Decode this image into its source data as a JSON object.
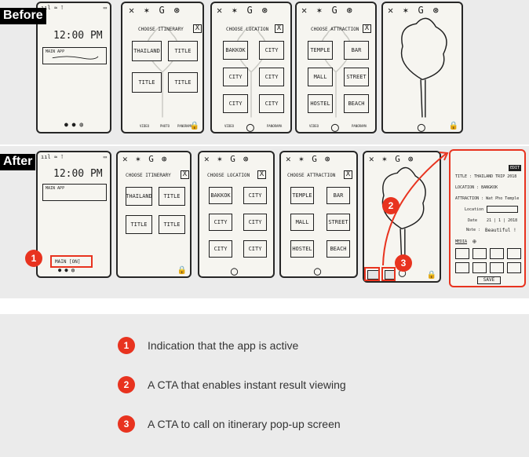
{
  "labels": {
    "before": "Before",
    "after": "After"
  },
  "lock_screen": {
    "time": "12:00 PM",
    "status_left": "ııl ≈ ⊺",
    "notification": "MAIN APP",
    "active_label": "MAIN [ON]"
  },
  "screens": {
    "itinerary": {
      "title": "CHOOSE ITINERARY",
      "items": [
        "THAILAND",
        "TITLE",
        "TITLE",
        "TITLE"
      ]
    },
    "location": {
      "title": "CHOOSE LOCATION",
      "items": [
        "BAKKOK",
        "CITY",
        "CITY",
        "CITY",
        "CITY",
        "CITY"
      ]
    },
    "attraction": {
      "title": "CHOOSE ATTRACTION",
      "items": [
        "TEMPLE",
        "BAR",
        "MALL",
        "STREET",
        "HOSTEL",
        "BEACH"
      ]
    },
    "close_mark": "X",
    "nav": [
      "VIDEO",
      "PHOTO",
      "PANORAMA"
    ]
  },
  "detail": {
    "badge": "EDIT",
    "title_line": "TITLE : THAILAND TRIP 2018",
    "location_line": "LOCATION : BANGKOK",
    "attraction_line": "ATTRACTION : Wat Pho Temple",
    "location_field": "Location",
    "date_label": "Date",
    "date_value": "21 | 1 | 2018",
    "note_label": "Note :",
    "note_value": "Beautiful !",
    "media": "MEDIA",
    "save": "SAVE"
  },
  "badges": [
    "1",
    "2",
    "3"
  ],
  "legend": [
    {
      "num": "1",
      "text": "Indication that the app is active"
    },
    {
      "num": "2",
      "text": "A CTA that enables instant result viewing"
    },
    {
      "num": "3",
      "text": "A CTA to call on itinerary pop-up screen"
    }
  ],
  "colors": {
    "accent": "#e8331f",
    "panel": "#ebebeb",
    "paper": "#f6f5f0",
    "ink": "#1f1f1f"
  }
}
